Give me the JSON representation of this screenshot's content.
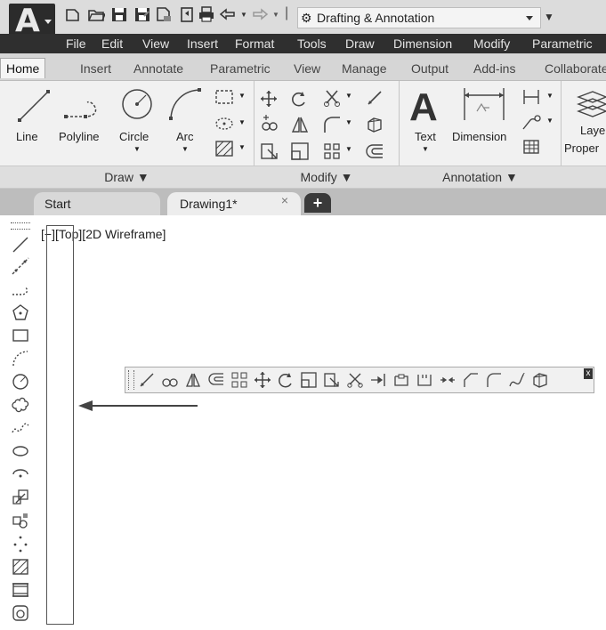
{
  "workspace": {
    "label": "Drafting & Annotation"
  },
  "menu": [
    "File",
    "Edit",
    "View",
    "Insert",
    "Format",
    "Tools",
    "Draw",
    "Dimension",
    "Modify",
    "Parametric"
  ],
  "ribbon_tabs": [
    "Home",
    "Insert",
    "Annotate",
    "Parametric",
    "View",
    "Manage",
    "Output",
    "Add-ins",
    "Collaborate"
  ],
  "active_ribbon_tab": "Home",
  "draw_panel": {
    "title": "Draw ▼",
    "line_label": "Line",
    "polyline_label": "Polyline",
    "circle_label": "Circle",
    "arc_label": "Arc"
  },
  "modify_panel": {
    "title": "Modify ▼"
  },
  "annotation_panel": {
    "title": "Annotation ▼",
    "text_label": "Text",
    "dimension_label": "Dimension"
  },
  "layers_panel": {
    "label_line1": "Laye",
    "label_line2": "Proper"
  },
  "file_tabs": {
    "start_label": "Start",
    "drawing_label": "Drawing1*",
    "close_glyph": "×",
    "new_glyph": "+"
  },
  "viewport": {
    "label": "[−][Top][2D Wireframe]"
  },
  "float_toolbar": {
    "close_glyph": "x"
  }
}
